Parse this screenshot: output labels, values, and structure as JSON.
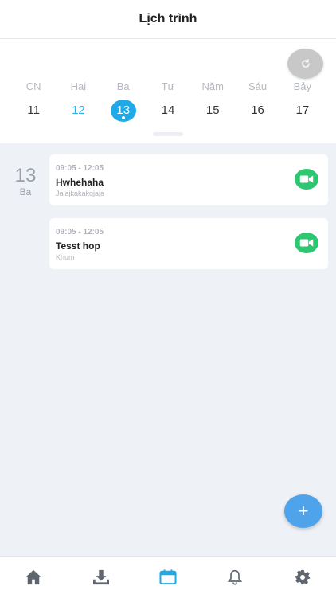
{
  "header": {
    "title": "Lịch trình"
  },
  "calendar": {
    "days": [
      {
        "name": "CN",
        "num": "11"
      },
      {
        "name": "Hai",
        "num": "12"
      },
      {
        "name": "Ba",
        "num": "13"
      },
      {
        "name": "Tư",
        "num": "14"
      },
      {
        "name": "Năm",
        "num": "15"
      },
      {
        "name": "Sáu",
        "num": "16"
      },
      {
        "name": "Bảy",
        "num": "17"
      }
    ],
    "today_index": 1,
    "selected_index": 2
  },
  "selected_date": {
    "day": "13",
    "weekday": "Ba"
  },
  "events": [
    {
      "time": "09:05 - 12:05",
      "title": "Hwhehaha",
      "description": "Jajajkakakqjaja",
      "action_icon": "video-camera-icon"
    },
    {
      "time": "09:05 - 12:05",
      "title": "Tesst hop",
      "description": "Khum",
      "action_icon": "video-camera-icon"
    }
  ],
  "fab": {
    "label": "+"
  },
  "tabbar": {
    "items": [
      {
        "icon": "home-icon",
        "active": false
      },
      {
        "icon": "download-icon",
        "active": false
      },
      {
        "icon": "calendar-icon",
        "active": true
      },
      {
        "icon": "bell-icon",
        "active": false
      },
      {
        "icon": "gear-icon",
        "active": false
      }
    ]
  },
  "colors": {
    "accent": "#1fa9e6",
    "video_green": "#2ec771",
    "fab_blue": "#4fa3ea",
    "inactive_icon": "#5f6670"
  }
}
